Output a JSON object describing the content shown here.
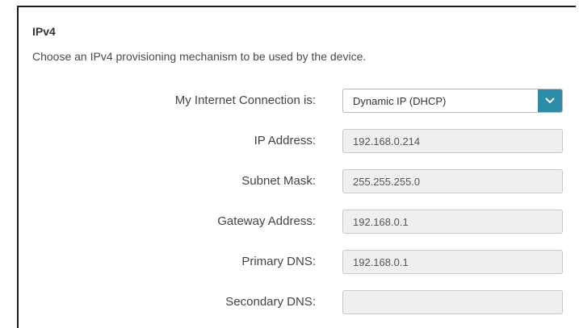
{
  "section": {
    "title": "IPv4",
    "description": "Choose an IPv4 provisioning mechanism to be used by the device."
  },
  "connection": {
    "label": "My Internet Connection is:",
    "selected": "Dynamic IP (DHCP)",
    "arrow_icon": "chevron-down-icon"
  },
  "fields": [
    {
      "label": "IP Address:",
      "value": "192.168.0.214"
    },
    {
      "label": "Subnet Mask:",
      "value": "255.255.255.0"
    },
    {
      "label": "Gateway Address:",
      "value": "192.168.0.1"
    },
    {
      "label": "Primary DNS:",
      "value": "192.168.0.1"
    },
    {
      "label": "Secondary DNS:",
      "value": ""
    }
  ],
  "colors": {
    "accent": "#2d8da8",
    "readonly_bg": "#efefef"
  }
}
